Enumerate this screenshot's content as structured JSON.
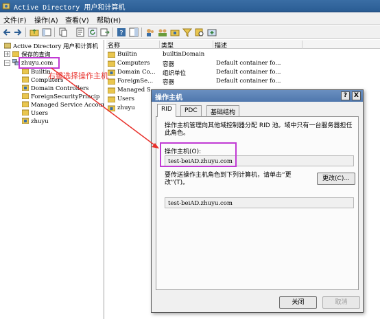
{
  "window": {
    "title": "Active Directory 用户和计算机"
  },
  "menu": [
    "文件(F)",
    "操作(A)",
    "查看(V)",
    "帮助(H)"
  ],
  "toolbar": {
    "icons": [
      "back-icon",
      "forward-icon",
      "up-folder-icon",
      "console-tree-icon",
      "copy-icon",
      "properties-icon",
      "refresh-icon",
      "export-icon",
      "help-icon",
      "show-pane-icon",
      "users-icon",
      "groups-icon",
      "filter-icon",
      "find-icon",
      "add-to-group-icon"
    ]
  },
  "tree": {
    "root": "Active Directory 用户和计算机",
    "saved_queries": "保存的查询",
    "domain": "zhuyu.com",
    "children": [
      "Builtin",
      "Computers",
      "Domain Controllers",
      "ForeignSecurityPrincip",
      "Managed Service Accour",
      "Users",
      "zhuyu"
    ]
  },
  "list": {
    "columns": [
      "名称",
      "类型",
      "描述"
    ],
    "rows": [
      {
        "name": "Builtin",
        "type": "builtinDomain",
        "desc": ""
      },
      {
        "name": "Computers",
        "type": "容器",
        "desc": "Default container fo..."
      },
      {
        "name": "Domain Co...",
        "type": "组织单位",
        "desc": "Default container fo..."
      },
      {
        "name": "ForeignSe...",
        "type": "容器",
        "desc": "Default container fo..."
      },
      {
        "name": "Managed S...",
        "type": "",
        "desc": ""
      },
      {
        "name": "Users",
        "type": "",
        "desc": ""
      },
      {
        "name": "zhuyu",
        "type": "",
        "desc": ""
      }
    ]
  },
  "annotation": {
    "text": "右键选择操作主机",
    "color": "#e8312c",
    "box_color": "#c13ad4"
  },
  "dialog": {
    "title": "操作主机",
    "help_btn": "?",
    "close_btn": "X",
    "tabs": [
      "RID",
      "PDC",
      "基础结构"
    ],
    "description": "操作主机管理向其他域控制器分配 RID 池。域中只有一台服务器担任此角色。",
    "op_master_label": "操作主机(O):",
    "op_master_value": "test-beiAD.zhuyu.com",
    "transfer_text": "要传送操作主机角色到下列计算机，请单击“更改”(T)。",
    "change_button": "更改(C)...",
    "target_value": "test-beiAD.zhuyu.com",
    "close_button": "关闭",
    "cancel_button": "取消"
  }
}
